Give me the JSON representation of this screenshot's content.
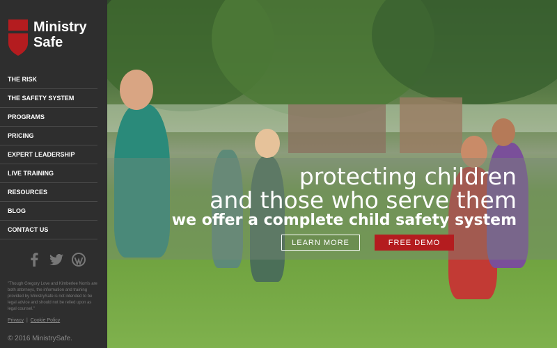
{
  "brand": {
    "name_line1": "Ministry",
    "name_line2": "Safe",
    "accent": "#b41c1f"
  },
  "nav": {
    "items": [
      {
        "label": "THE RISK"
      },
      {
        "label": "THE SAFETY SYSTEM"
      },
      {
        "label": "PROGRAMS"
      },
      {
        "label": "PRICING"
      },
      {
        "label": "EXPERT LEADERSHIP"
      },
      {
        "label": "LIVE TRAINING"
      },
      {
        "label": "RESOURCES"
      },
      {
        "label": "BLOG"
      },
      {
        "label": "CONTACT US"
      }
    ]
  },
  "social": {
    "icons": [
      "facebook-icon",
      "twitter-icon",
      "wordpress-icon"
    ]
  },
  "disclaimer": "\"Though Gregory Love and Kimberlee Norris are both attorneys, the information and training provided by MinistrySafe is not intended to be legal advice and should not be relied upon as legal counsel.\"",
  "footer_links": {
    "privacy": "Privacy",
    "cookie_policy": "Cookie Policy"
  },
  "copyright": "© 2016 MinistrySafe.",
  "hero": {
    "line1": "protecting children",
    "line2": "and those who serve them",
    "line3": "we offer a complete child safety system",
    "learn_more": "LEARN MORE",
    "free_demo": "FREE DEMO"
  }
}
